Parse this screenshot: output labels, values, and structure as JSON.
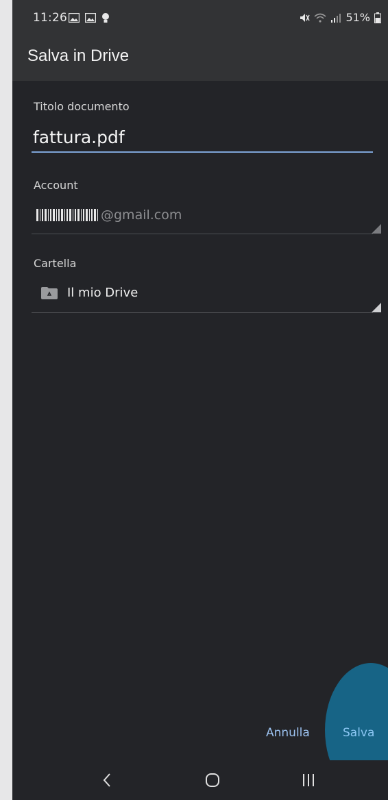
{
  "status_bar": {
    "time": "11:26",
    "battery": "51%",
    "icons": [
      "gallery-icon",
      "gallery-icon",
      "bulb-icon",
      "mute-icon",
      "wifi-icon",
      "signal-icon",
      "battery-icon"
    ]
  },
  "app_bar": {
    "title": "Salva in Drive"
  },
  "form": {
    "title_field": {
      "label": "Titolo documento",
      "value": "fattura.pdf"
    },
    "account_field": {
      "label": "Account",
      "value_suffix": "@gmail.com"
    },
    "folder_field": {
      "label": "Cartella",
      "value": "Il mio Drive"
    }
  },
  "actions": {
    "cancel_label": "Annulla",
    "save_label": "Salva"
  },
  "colors": {
    "background": "#232428",
    "app_bar": "#323335",
    "accent": "#7fa5d9",
    "ripple": "#176486"
  }
}
